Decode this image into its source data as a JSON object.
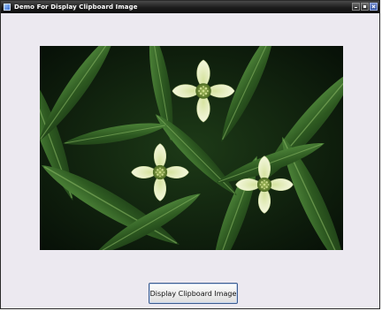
{
  "window": {
    "title": "Demo For Display Clipboard Image",
    "controls": {
      "minimize_icon": "minimize-icon",
      "maximize_icon": "maximize-icon",
      "close_icon": "close-icon"
    }
  },
  "picture": {
    "subject": "bunchberry-flowers-photo",
    "colors": {
      "background": "#0f1a0f",
      "leaf": "#2f5a23",
      "leaf_light": "#4f8a3a",
      "petal": "#eef3cf",
      "center": "#7d9a3a"
    }
  },
  "buttons": {
    "display_label": "Display Clipboard Image"
  }
}
